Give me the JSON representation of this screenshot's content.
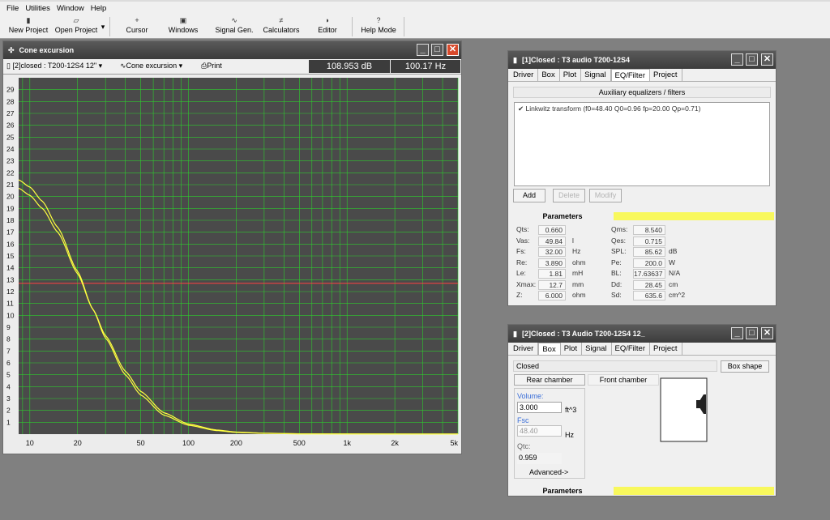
{
  "menu": [
    "File",
    "Utilities",
    "Window",
    "Help"
  ],
  "toolbar": [
    {
      "icon": "new-project-icon",
      "glyph": "▮",
      "label": "New Project"
    },
    {
      "icon": "open-project-icon",
      "glyph": "▱",
      "label": "Open Project"
    },
    {
      "icon": "cursor-icon",
      "glyph": "+",
      "label": "Cursor"
    },
    {
      "icon": "windows-icon",
      "glyph": "▣",
      "label": "Windows"
    },
    {
      "icon": "signal-gen-icon",
      "glyph": "∿",
      "label": "Signal Gen."
    },
    {
      "icon": "calculators-icon",
      "glyph": "≠",
      "label": "Calculators"
    },
    {
      "icon": "editor-icon",
      "glyph": "◗",
      "label": "Editor"
    },
    {
      "icon": "help-mode-icon",
      "glyph": "?",
      "label": "Help Mode"
    }
  ],
  "cone": {
    "title": "Cone excursion",
    "project_select": "[2]closed : T200-12S4 12\"",
    "view_select": "Cone excursion",
    "print": "Print",
    "readout_db": "108.953 dB",
    "readout_hz": "100.17 Hz"
  },
  "chart_data": {
    "type": "line",
    "title": "Cone excursion",
    "xlabel": "",
    "ylabel": "",
    "xscale": "log",
    "xlim": [
      8.5,
      5000
    ],
    "ylim": [
      0,
      30
    ],
    "xticks": [
      10,
      20,
      50,
      100,
      200,
      500,
      1000,
      2000,
      5000
    ],
    "xtick_labels": [
      "10",
      "20",
      "50",
      "100",
      "200",
      "500",
      "1k",
      "2k",
      "5k"
    ],
    "yticks": [
      1,
      2,
      3,
      4,
      5,
      6,
      7,
      8,
      9,
      10,
      11,
      12,
      13,
      14,
      15,
      16,
      17,
      18,
      19,
      20,
      21,
      22,
      23,
      24,
      25,
      26,
      27,
      28,
      29
    ],
    "grid": true,
    "cursor_y": 12.7,
    "colors": {
      "background": "#4a4a4a",
      "grid": "#2ecc2e",
      "curve": "#ffff40",
      "cursor": "#ff4040"
    },
    "series": [
      {
        "x": [
          8.5,
          10,
          12,
          15,
          20,
          25,
          30,
          40,
          50,
          70,
          100,
          150,
          200,
          300,
          500
        ],
        "y": [
          21.4,
          20.8,
          19.6,
          17.4,
          13.7,
          10.5,
          8.1,
          5.0,
          3.3,
          1.6,
          0.75,
          0.3,
          0.15,
          0.07,
          0.02
        ]
      },
      {
        "x": [
          8.5,
          10,
          12,
          15,
          20,
          25,
          30,
          40,
          50,
          70,
          100,
          150,
          200,
          300,
          500
        ],
        "y": [
          20.7,
          20.1,
          19.0,
          17.0,
          13.5,
          10.5,
          8.3,
          5.3,
          3.6,
          1.8,
          0.85,
          0.35,
          0.18,
          0.08,
          0.03
        ]
      }
    ]
  },
  "w1": {
    "title": "[1]Closed : T3 audio T200-12S4",
    "tabs": [
      "Driver",
      "Box",
      "Plot",
      "Signal",
      "EQ/Filter",
      "Project"
    ],
    "active_tab": "EQ/Filter",
    "aux_header": "Auxiliary equalizers / filters",
    "filter_item": "Linkwitz transform (f0=48.40 Q0=0.96 fp=20.00 Qp=0.71)",
    "btn_add": "Add",
    "btn_delete": "Delete",
    "btn_modify": "Modify",
    "params_title": "Parameters",
    "params": [
      {
        "l": "Qts:",
        "v": "0.660",
        "u": ""
      },
      {
        "l": "Vas:",
        "v": "49.84",
        "u": "l"
      },
      {
        "l": "Fs:",
        "v": "32.00",
        "u": "Hz"
      },
      {
        "l": "Re:",
        "v": "3.890",
        "u": "ohm"
      },
      {
        "l": "Le:",
        "v": "1.81",
        "u": "mH"
      },
      {
        "l": "Xmax:",
        "v": "12.7",
        "u": "mm"
      },
      {
        "l": "Z:",
        "v": "6.000",
        "u": "ohm"
      }
    ],
    "params2": [
      {
        "l": "Qms:",
        "v": "8.540",
        "u": ""
      },
      {
        "l": "Qes:",
        "v": "0.715",
        "u": ""
      },
      {
        "l": "SPL:",
        "v": "85.62",
        "u": "dB"
      },
      {
        "l": "Pe:",
        "v": "200.0",
        "u": "W"
      },
      {
        "l": "BL:",
        "v": "17.63637",
        "u": "N/A"
      },
      {
        "l": "Dd:",
        "v": "28.45",
        "u": "cm"
      },
      {
        "l": "Sd:",
        "v": "635.6",
        "u": "cm^2"
      }
    ]
  },
  "w2": {
    "title": "[2]Closed : T3 Audio T200-12S4 12_",
    "tabs": [
      "Driver",
      "Box",
      "Plot",
      "Signal",
      "EQ/Filter",
      "Project"
    ],
    "active_tab": "Box",
    "box_type": "Closed",
    "box_shape": "Box shape",
    "rear": "Rear chamber",
    "front": "Front chamber",
    "volume_label": "Volume:",
    "volume": "3.000",
    "volume_unit": "ft^3",
    "fsc_label": "Fsc",
    "fsc": "48.40",
    "fsc_unit": "Hz",
    "qtc_label": "Qtc:",
    "qtc": "0.959",
    "advanced": "Advanced->",
    "params_title": "Parameters"
  }
}
